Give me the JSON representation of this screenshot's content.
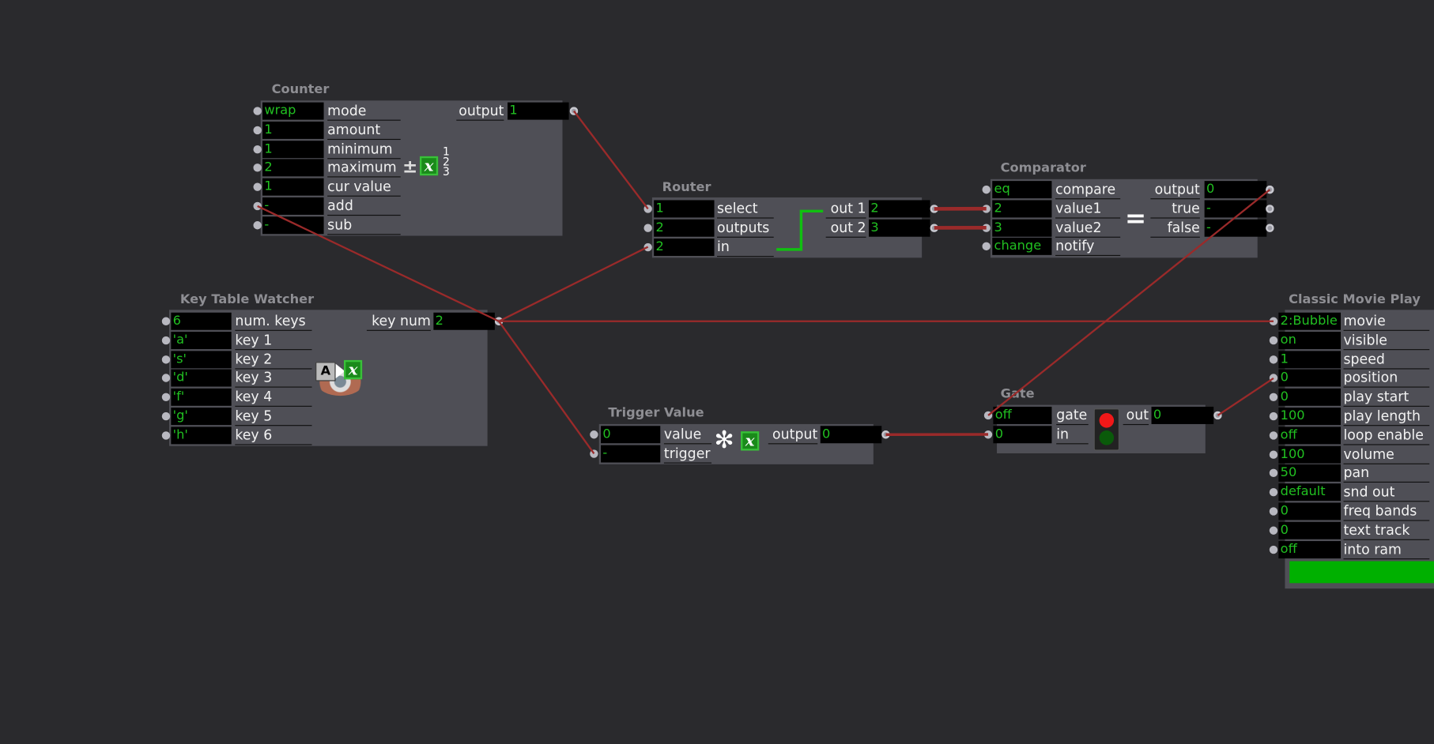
{
  "colors": {
    "background": "#2a2a2d",
    "actor_body": "#4f4f56",
    "value_text": "#21c021",
    "wire": "#9a2a2a",
    "internal_route": "#10c010",
    "progress": "#00b000"
  },
  "actors": [
    {
      "id": "counter",
      "title": "Counter",
      "inputs": [
        {
          "value": "wrap",
          "label": "mode"
        },
        {
          "value": "1",
          "label": "amount"
        },
        {
          "value": "1",
          "label": "minimum"
        },
        {
          "value": "2",
          "label": "maximum"
        },
        {
          "value": "1",
          "label": "cur value"
        },
        {
          "value": "-",
          "label": "add"
        },
        {
          "value": "-",
          "label": "sub"
        }
      ],
      "outputs": [
        {
          "value": "1",
          "label": "output"
        }
      ],
      "icon": "counter-icon",
      "icon_digits": [
        "1",
        "2",
        "3"
      ]
    },
    {
      "id": "router",
      "title": "Router",
      "inputs": [
        {
          "value": "1",
          "label": "select"
        },
        {
          "value": "2",
          "label": "outputs"
        },
        {
          "value": "2",
          "label": "in"
        }
      ],
      "outputs": [
        {
          "value": "2",
          "label": "out 1"
        },
        {
          "value": "3",
          "label": "out 2"
        }
      ]
    },
    {
      "id": "comparator",
      "title": "Comparator",
      "inputs": [
        {
          "value": "eq",
          "label": "compare"
        },
        {
          "value": "2",
          "label": "value1"
        },
        {
          "value": "3",
          "label": "value2"
        },
        {
          "value": "change",
          "label": "notify"
        }
      ],
      "outputs": [
        {
          "value": "0",
          "label": "output"
        },
        {
          "value": "-",
          "label": "true"
        },
        {
          "value": "-",
          "label": "false"
        }
      ],
      "icon": "equals-icon",
      "icon_symbol": "="
    },
    {
      "id": "ktw",
      "title": "Key Table Watcher",
      "inputs": [
        {
          "value": "6",
          "label": "num. keys"
        },
        {
          "value": "'a'",
          "label": "key 1"
        },
        {
          "value": "'s'",
          "label": "key 2"
        },
        {
          "value": "'d'",
          "label": "key 3"
        },
        {
          "value": "'f'",
          "label": "key 4"
        },
        {
          "value": "'g'",
          "label": "key 5"
        },
        {
          "value": "'h'",
          "label": "key 6"
        }
      ],
      "outputs": [
        {
          "value": "2",
          "label": "key num"
        }
      ],
      "icon": "keyboard-eye-icon"
    },
    {
      "id": "trigger",
      "title": "Trigger Value",
      "inputs": [
        {
          "value": "0",
          "label": "value"
        },
        {
          "value": "-",
          "label": "trigger"
        }
      ],
      "outputs": [
        {
          "value": "0",
          "label": "output"
        }
      ],
      "icon": "trigger-icon"
    },
    {
      "id": "gate",
      "title": "Gate",
      "inputs": [
        {
          "value": "off",
          "label": "gate"
        },
        {
          "value": "0",
          "label": "in"
        }
      ],
      "outputs": [
        {
          "value": "0",
          "label": "out"
        }
      ],
      "icon": "traffic-light-icon"
    },
    {
      "id": "movie",
      "title": "Classic Movie Play",
      "inputs": [
        {
          "value": "2:Bubble",
          "label": "movie"
        },
        {
          "value": "on",
          "label": "visible"
        },
        {
          "value": "1",
          "label": "speed"
        },
        {
          "value": "0",
          "label": "position"
        },
        {
          "value": "0",
          "label": "play start"
        },
        {
          "value": "100",
          "label": "play length"
        },
        {
          "value": "off",
          "label": "loop enable"
        },
        {
          "value": "100",
          "label": "volume"
        },
        {
          "value": "50",
          "label": "pan"
        },
        {
          "value": "default",
          "label": "snd out"
        },
        {
          "value": "0",
          "label": "freq bands"
        },
        {
          "value": "0",
          "label": "text track"
        },
        {
          "value": "off",
          "label": "into ram"
        }
      ],
      "outputs": [],
      "progress_percent": 100
    }
  ]
}
